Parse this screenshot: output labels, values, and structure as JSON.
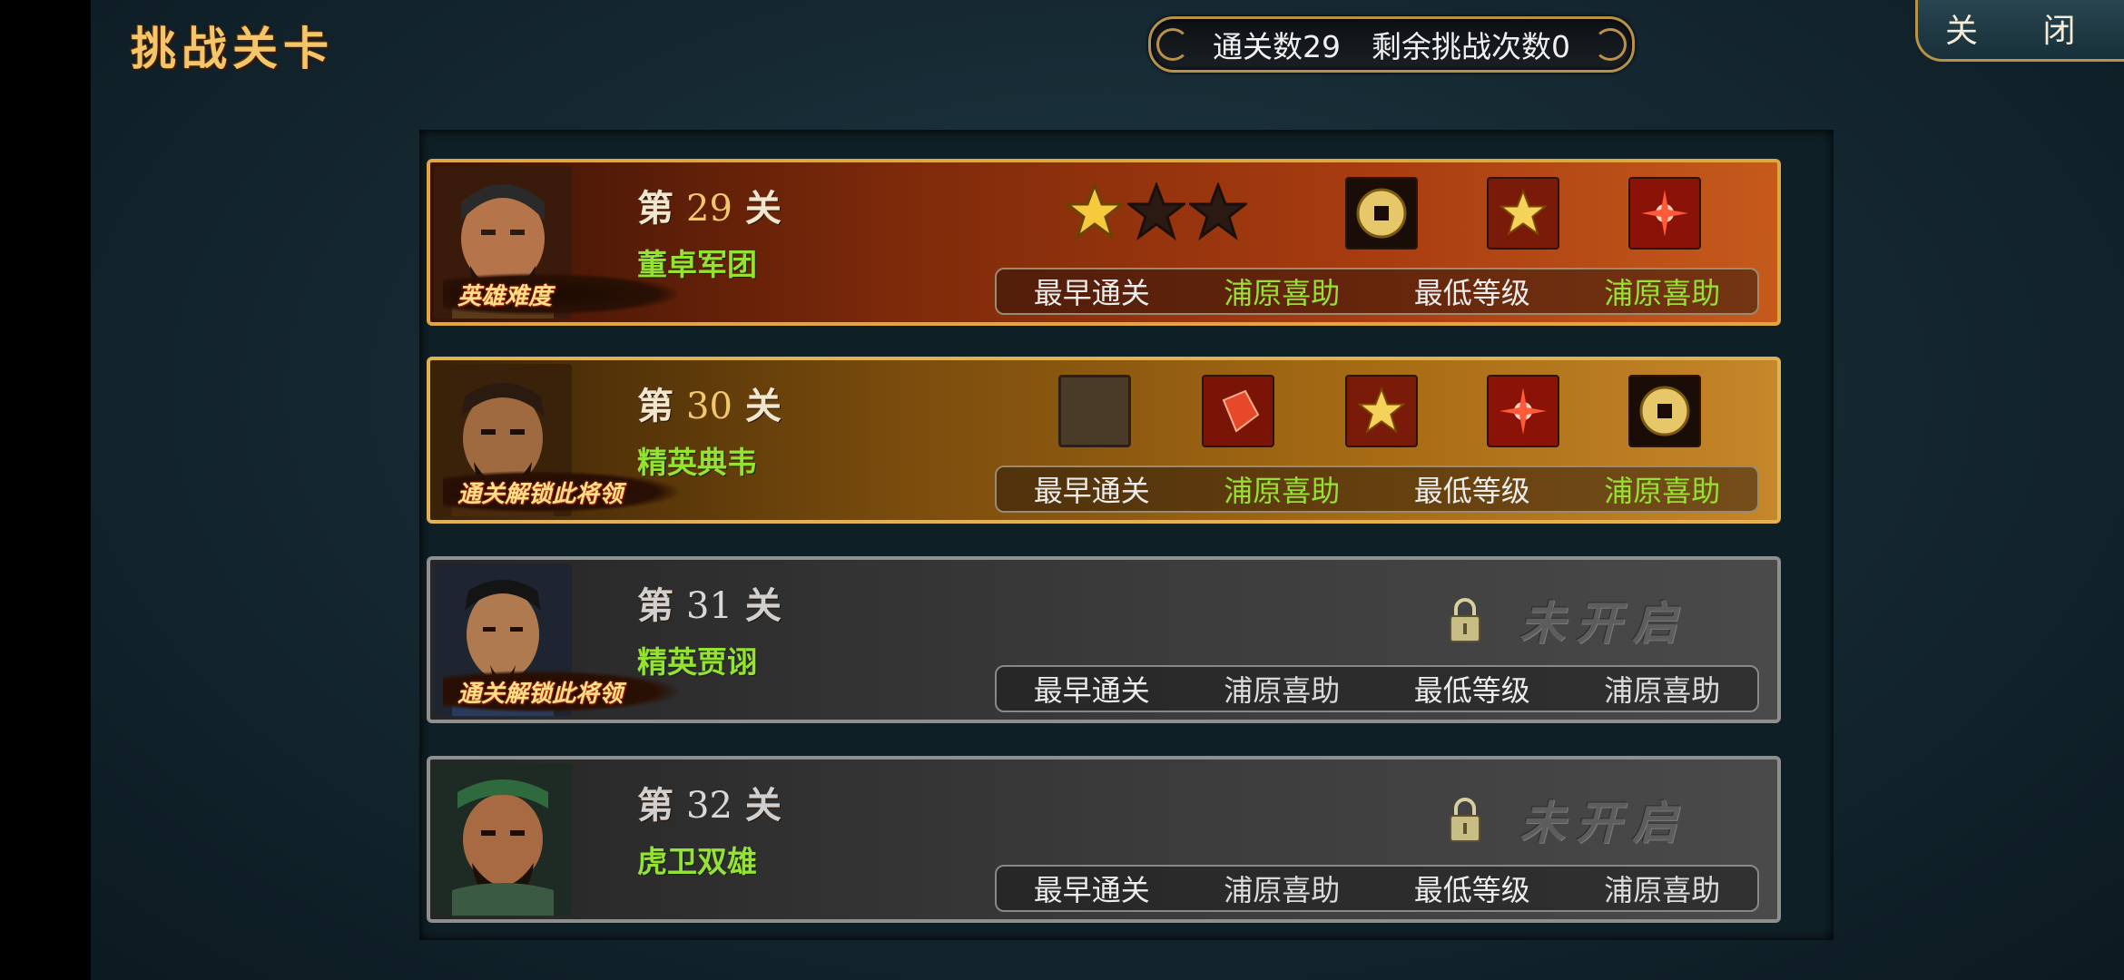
{
  "header": {
    "title": "挑战关卡",
    "cleared_label": "通关数29",
    "remaining_label": "剩余挑战次数0",
    "close_label": "关 闭"
  },
  "colors": {
    "accent_gold": "#e1a63f",
    "name_green": "#95e233",
    "hero_row": "#a93c10",
    "elite_row": "#a76b14",
    "locked_row": "#3a3a3a"
  },
  "stages": [
    {
      "prefix": "第",
      "number": "29",
      "suffix": "关",
      "name": "董卓军团",
      "badge": "英雄难度",
      "status": "active",
      "stars_earned": 1,
      "stars_total": 3,
      "rewards": [
        "coin-icon",
        "exp-star-icon",
        "red-burst-icon"
      ],
      "info": {
        "earliest_label": "最早通关",
        "earliest_value": "浦原喜助",
        "lowest_label": "最低等级",
        "lowest_value": "浦原喜助"
      }
    },
    {
      "prefix": "第",
      "number": "30",
      "suffix": "关",
      "name": "精英典韦",
      "badge": "通关解锁此将领",
      "status": "active",
      "rewards": [
        "empty-slot",
        "red-gem-icon",
        "exp-star-icon",
        "red-burst-icon",
        "coin-icon"
      ],
      "info": {
        "earliest_label": "最早通关",
        "earliest_value": "浦原喜助",
        "lowest_label": "最低等级",
        "lowest_value": "浦原喜助"
      }
    },
    {
      "prefix": "第",
      "number": "31",
      "suffix": "关",
      "name": "精英贾诩",
      "badge": "通关解锁此将领",
      "status": "locked",
      "locked_label": "未开启",
      "info": {
        "earliest_label": "最早通关",
        "earliest_value": "浦原喜助",
        "lowest_label": "最低等级",
        "lowest_value": "浦原喜助"
      }
    },
    {
      "prefix": "第",
      "number": "32",
      "suffix": "关",
      "name": "虎卫双雄",
      "status": "locked",
      "locked_label": "未开启",
      "info": {
        "earliest_label": "最早通关",
        "earliest_value": "浦原喜助",
        "lowest_label": "最低等级",
        "lowest_value": "浦原喜助"
      }
    }
  ]
}
